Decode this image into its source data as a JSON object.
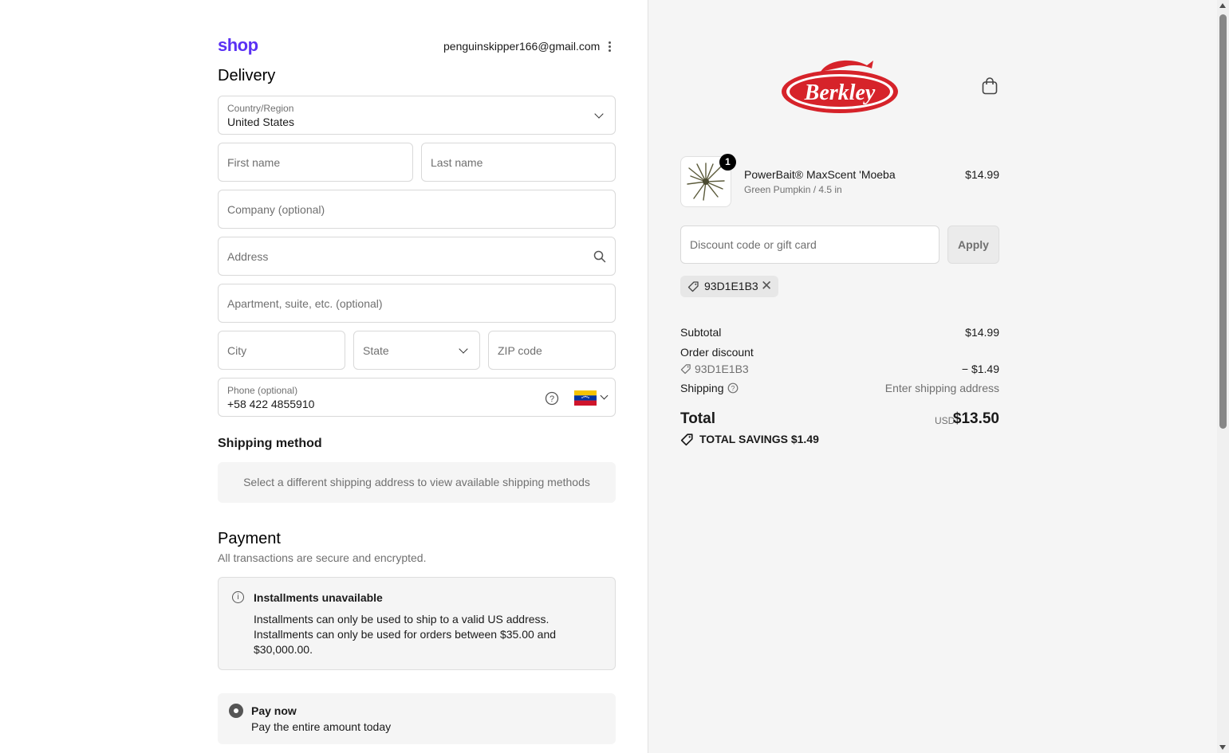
{
  "header": {
    "logo_text": "shop",
    "email": "penguinskipper166@gmail.com"
  },
  "delivery": {
    "title": "Delivery",
    "country_label": "Country/Region",
    "country_value": "United States",
    "first_name_placeholder": "First name",
    "last_name_placeholder": "Last name",
    "company_placeholder": "Company (optional)",
    "address_placeholder": "Address",
    "apartment_placeholder": "Apartment, suite, etc. (optional)",
    "city_placeholder": "City",
    "state_placeholder": "State",
    "zip_placeholder": "ZIP code",
    "phone_label": "Phone (optional)",
    "phone_value": "+58 422 4855910"
  },
  "shipping": {
    "title": "Shipping method",
    "notice": "Select a different shipping address to view available shipping methods"
  },
  "payment": {
    "title": "Payment",
    "subtitle": "All transactions are secure and encrypted.",
    "alert_title": "Installments unavailable",
    "alert_lines": [
      "Installments can only be used to ship to a valid US address.",
      "Installments can only be used for orders between $35.00 and",
      "$30,000.00."
    ],
    "option_title": "Pay now",
    "option_subtitle": "Pay the entire amount today"
  },
  "brand": {
    "name": "Berkley",
    "color": "#d6232a"
  },
  "cart": {
    "quantity": "1",
    "product_name": "PowerBait® MaxScent 'Moeba",
    "product_variant": "Green Pumpkin / 4.5 in",
    "product_price": "$14.99",
    "discount_placeholder": "Discount code or gift card",
    "apply_label": "Apply",
    "applied_code": "93D1E1B3"
  },
  "summary": {
    "subtotal_label": "Subtotal",
    "subtotal_value": "$14.99",
    "order_discount_label": "Order discount",
    "discount_code": "93D1E1B3",
    "discount_value": "− $1.49",
    "shipping_label": "Shipping",
    "shipping_value": "Enter shipping address",
    "total_label": "Total",
    "total_currency": "USD",
    "total_value": "$13.50",
    "savings_text": "TOTAL SAVINGS  $1.49"
  }
}
